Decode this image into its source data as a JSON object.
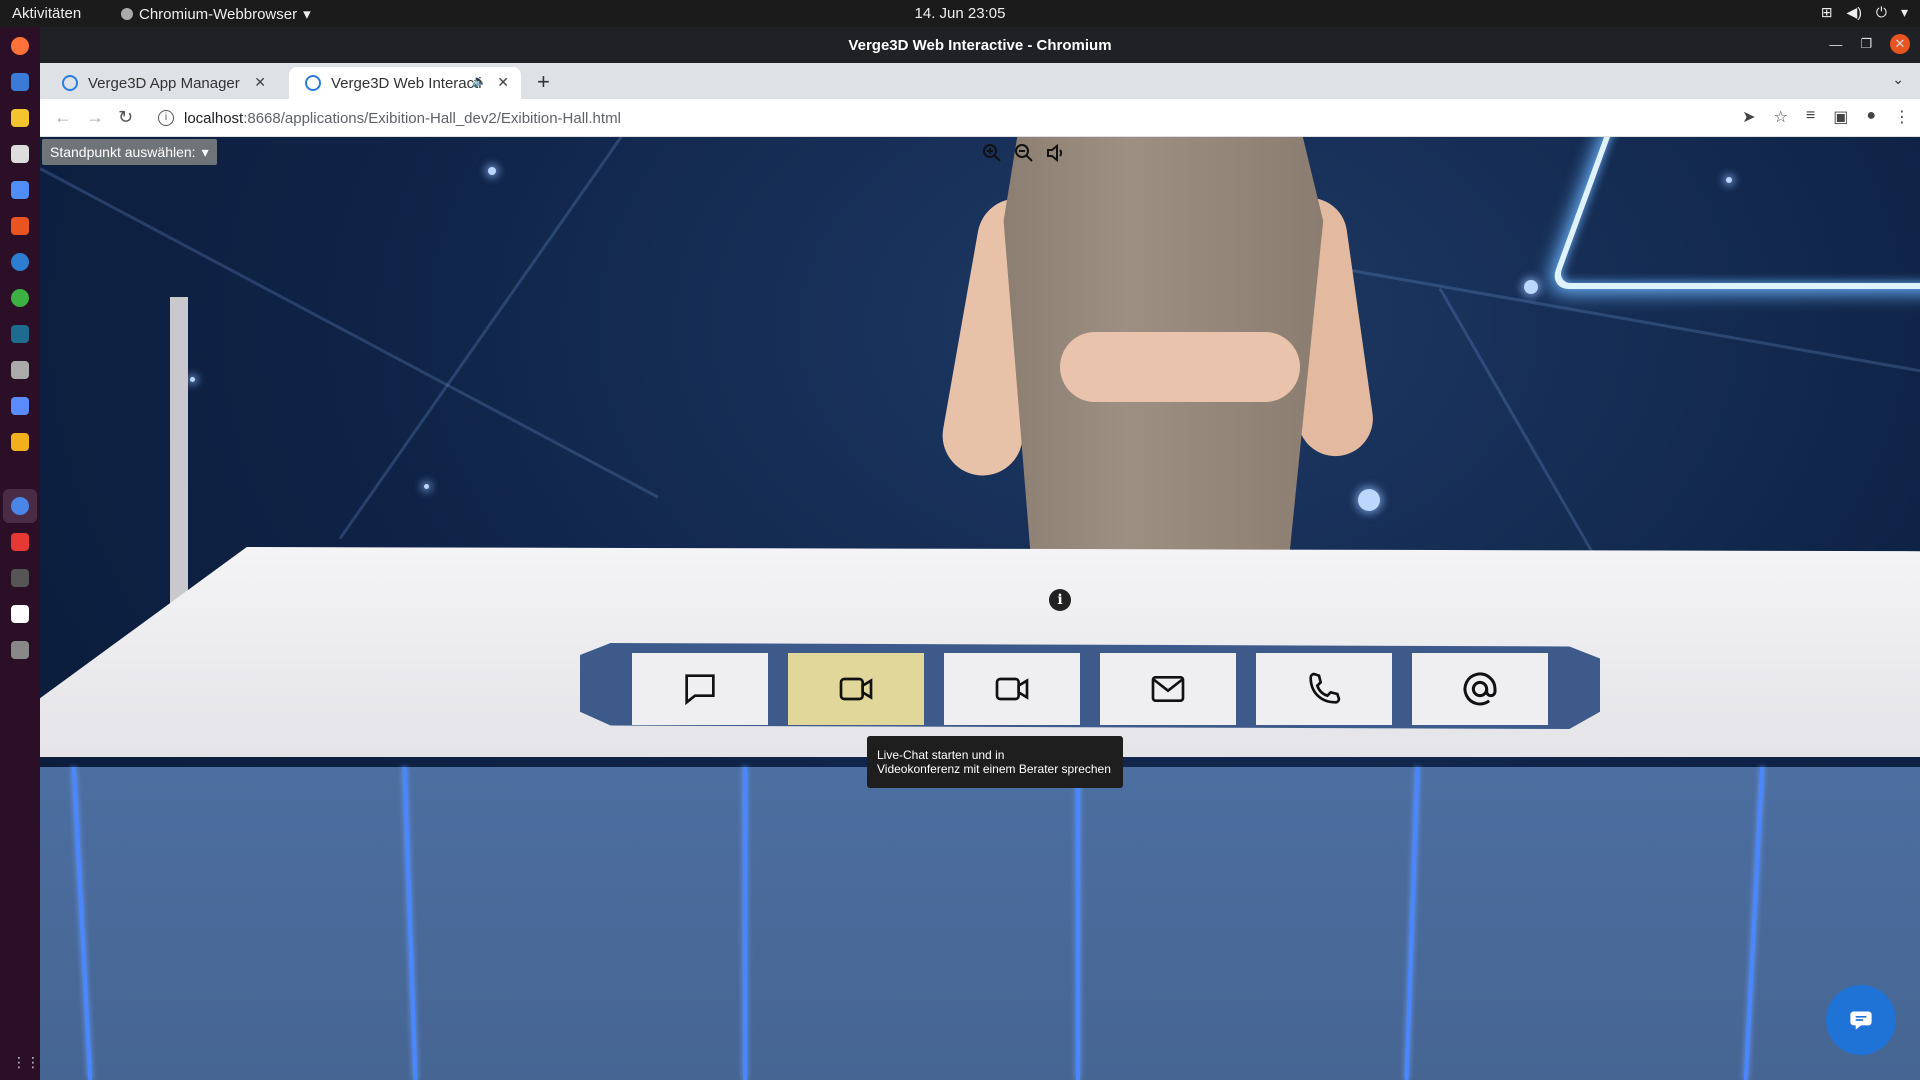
{
  "os": {
    "activities": "Aktivitäten",
    "app_menu": "Chromium-Webbrowser",
    "clock": "14. Jun  23:05"
  },
  "window": {
    "title": "Verge3D Web Interactive - Chromium"
  },
  "tabs": [
    {
      "label": "Verge3D App Manager"
    },
    {
      "label": "Verge3D Web Interactive"
    }
  ],
  "address": {
    "host": "localhost",
    "path": ":8668/applications/Exibition-Hall_dev2/Exibition-Hall.html"
  },
  "app": {
    "standpoint_label": "Standpunkt auswählen:",
    "info_glyph": "i",
    "tooltip_line1": "Live-Chat starten und in",
    "tooltip_line2": "Videokonferenz mit einem Berater sprechen",
    "buttons": [
      {
        "icon": "chat-bubble-icon"
      },
      {
        "icon": "video-camera-icon",
        "highlighted": true
      },
      {
        "icon": "video-camera-icon"
      },
      {
        "icon": "envelope-icon"
      },
      {
        "icon": "phone-icon"
      },
      {
        "icon": "at-sign-icon"
      }
    ],
    "highlight_color": "#e1d79a",
    "accent_blue": "#4a86ff"
  }
}
